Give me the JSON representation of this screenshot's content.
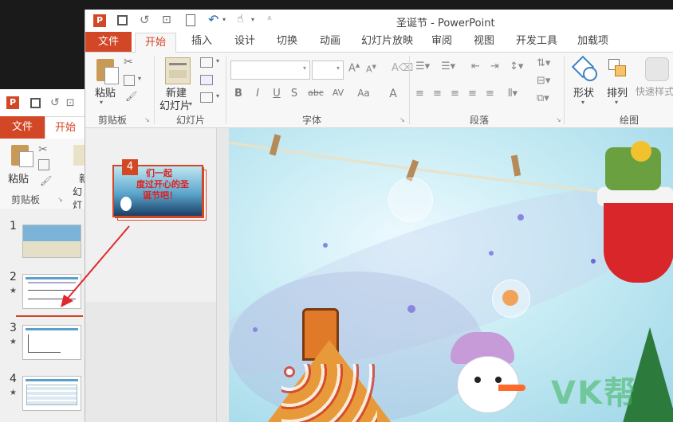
{
  "back_window": {
    "tabs": {
      "file": "文件",
      "home": "开始"
    },
    "group_clipboard": "剪贴板",
    "paste_label": "粘贴",
    "new_slide_partial": "新",
    "layout_partial": "幻灯",
    "thumbnails": [
      {
        "number": "1",
        "star": ""
      },
      {
        "number": "2",
        "star": "★"
      },
      {
        "number": "3",
        "star": "★"
      },
      {
        "number": "4",
        "star": "★"
      }
    ]
  },
  "front_window": {
    "title": "圣诞节 - PowerPoint",
    "tabs": [
      "文件",
      "开始",
      "插入",
      "设计",
      "切换",
      "动画",
      "幻灯片放映",
      "审阅",
      "视图",
      "开发工具",
      "加载项"
    ],
    "groups": {
      "clipboard": "剪贴板",
      "slides": "幻灯片",
      "font": "字体",
      "paragraph": "段落",
      "drawing": "绘图"
    },
    "paste_label": "粘贴",
    "new_slide_label": [
      "新建",
      "幻灯片"
    ],
    "shape_label": "形状",
    "arrange_label": "排列",
    "quick_styles_label": "快速样式",
    "font_buttons": [
      "B",
      "I",
      "U",
      "S",
      "abc",
      "AV",
      "Aa",
      "A"
    ],
    "drag_badge": "4",
    "drag_thumb_text": [
      "们一起",
      "度过开心的圣",
      "诞节吧！"
    ],
    "watermark": "VK帮"
  },
  "colors": {
    "accent": "#d24726",
    "arrow": "#e0282e",
    "slide_sky": "#c8ecf4",
    "ribbon_bg": "#f7f7f7"
  }
}
